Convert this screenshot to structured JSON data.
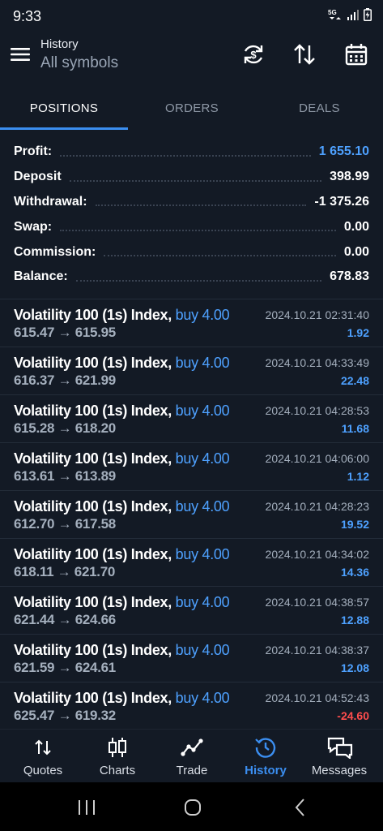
{
  "status_bar": {
    "time": "9:33",
    "network": "5G"
  },
  "header": {
    "title": "History",
    "subtitle": "All symbols"
  },
  "tabs": [
    {
      "label": "POSITIONS",
      "active": true
    },
    {
      "label": "ORDERS",
      "active": false
    },
    {
      "label": "DEALS",
      "active": false
    }
  ],
  "summary": [
    {
      "label": "Profit:",
      "value": "1 655.10",
      "highlight": true
    },
    {
      "label": "Deposit",
      "value": "398.99"
    },
    {
      "label": "Withdrawal:",
      "value": "-1 375.26"
    },
    {
      "label": "Swap:",
      "value": "0.00"
    },
    {
      "label": "Commission:",
      "value": "0.00"
    },
    {
      "label": "Balance:",
      "value": "678.83"
    }
  ],
  "trades": [
    {
      "symbol": "Volatility 100 (1s) Index,",
      "side": "buy 4.00",
      "prices": "615.47 → 615.95",
      "datetime": "2024.10.21 02:31:40",
      "profit": "1.92"
    },
    {
      "symbol": "Volatility 100 (1s) Index,",
      "side": "buy 4.00",
      "prices": "616.37 → 621.99",
      "datetime": "2024.10.21 04:33:49",
      "profit": "22.48"
    },
    {
      "symbol": "Volatility 100 (1s) Index,",
      "side": "buy 4.00",
      "prices": "615.28 → 618.20",
      "datetime": "2024.10.21 04:28:53",
      "profit": "11.68"
    },
    {
      "symbol": "Volatility 100 (1s) Index,",
      "side": "buy 4.00",
      "prices": "613.61 → 613.89",
      "datetime": "2024.10.21 04:06:00",
      "profit": "1.12"
    },
    {
      "symbol": "Volatility 100 (1s) Index,",
      "side": "buy 4.00",
      "prices": "612.70 → 617.58",
      "datetime": "2024.10.21 04:28:23",
      "profit": "19.52"
    },
    {
      "symbol": "Volatility 100 (1s) Index,",
      "side": "buy 4.00",
      "prices": "618.11 → 621.70",
      "datetime": "2024.10.21 04:34:02",
      "profit": "14.36"
    },
    {
      "symbol": "Volatility 100 (1s) Index,",
      "side": "buy 4.00",
      "prices": "621.44 → 624.66",
      "datetime": "2024.10.21 04:38:57",
      "profit": "12.88"
    },
    {
      "symbol": "Volatility 100 (1s) Index,",
      "side": "buy 4.00",
      "prices": "621.59 → 624.61",
      "datetime": "2024.10.21 04:38:37",
      "profit": "12.08"
    },
    {
      "symbol": "Volatility 100 (1s) Index,",
      "side": "buy 4.00",
      "prices": "625.47 → 619.32",
      "datetime": "2024.10.21 04:52:43",
      "profit": "-24.60"
    }
  ],
  "bottom_nav": [
    {
      "label": "Quotes",
      "icon": "arrows-updown-icon",
      "active": false
    },
    {
      "label": "Charts",
      "icon": "candlestick-icon",
      "active": false
    },
    {
      "label": "Trade",
      "icon": "trend-line-icon",
      "active": false
    },
    {
      "label": "History",
      "icon": "history-clock-icon",
      "active": true
    },
    {
      "label": "Messages",
      "icon": "chat-bubbles-icon",
      "active": false
    }
  ],
  "colors": {
    "background": "#131a25",
    "accent": "#3b8ef0",
    "positive": "#4ea1ff",
    "negative": "#ff4d4d"
  }
}
